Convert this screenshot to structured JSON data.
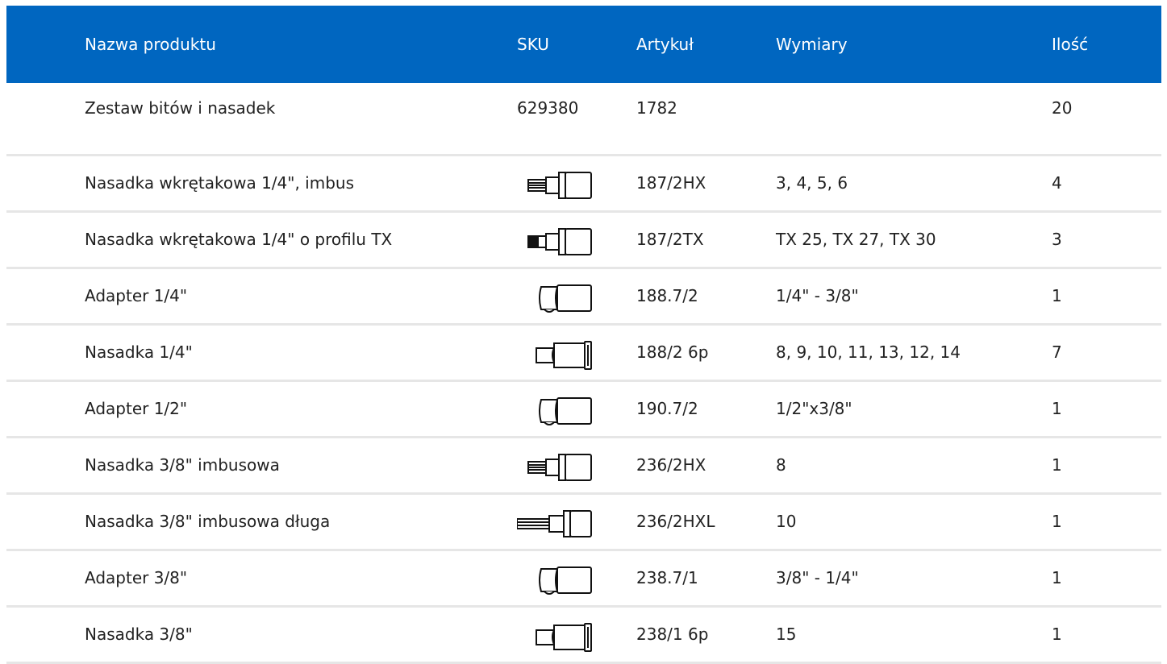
{
  "table": {
    "headers": {
      "name": "Nazwa produktu",
      "sku": "SKU",
      "article": "Artykuł",
      "dimensions": "Wymiary",
      "qty": "Ilość"
    },
    "header_color": "#0066c0",
    "rows": [
      {
        "name": "Zestaw bitów i nasadek",
        "sku": "629380",
        "sku_icon": "",
        "article": "1782",
        "dimensions": "",
        "qty": "20"
      },
      {
        "name": "Nasadka wkrętakowa 1/4\", imbus",
        "sku": "",
        "sku_icon": "hex-bit-socket-icon",
        "article": "187/2HX",
        "dimensions": "3, 4, 5, 6",
        "qty": "4"
      },
      {
        "name": "Nasadka wkrętakowa 1/4\" o profilu TX",
        "sku": "",
        "sku_icon": "torx-bit-socket-icon",
        "article": "187/2TX",
        "dimensions": "TX 25, TX 27, TX 30",
        "qty": "3"
      },
      {
        "name": "Adapter 1/4\"",
        "sku": "",
        "sku_icon": "adapter-icon",
        "article": "188.7/2",
        "dimensions": "1/4\" - 3/8\"",
        "qty": "1"
      },
      {
        "name": "Nasadka 1/4\"",
        "sku": "",
        "sku_icon": "socket-icon",
        "article": "188/2 6p",
        "dimensions": "8, 9, 10, 11, 13, 12, 14",
        "qty": "7"
      },
      {
        "name": "Adapter 1/2\"",
        "sku": "",
        "sku_icon": "adapter-icon",
        "article": "190.7/2",
        "dimensions": "1/2\"x3/8\"",
        "qty": "1"
      },
      {
        "name": "Nasadka 3/8\" imbusowa",
        "sku": "",
        "sku_icon": "hex-bit-socket-icon",
        "article": "236/2HX",
        "dimensions": "8",
        "qty": "1"
      },
      {
        "name": "Nasadka 3/8\" imbusowa długa",
        "sku": "",
        "sku_icon": "long-hex-bit-socket-icon",
        "article": "236/2HXL",
        "dimensions": "10",
        "qty": "1"
      },
      {
        "name": "Adapter 3/8\"",
        "sku": "",
        "sku_icon": "adapter-icon",
        "article": "238.7/1",
        "dimensions": "3/8\" - 1/4\"",
        "qty": "1"
      },
      {
        "name": "Nasadka 3/8\"",
        "sku": "",
        "sku_icon": "socket-icon",
        "article": "238/1 6p",
        "dimensions": "15",
        "qty": "1"
      }
    ]
  }
}
